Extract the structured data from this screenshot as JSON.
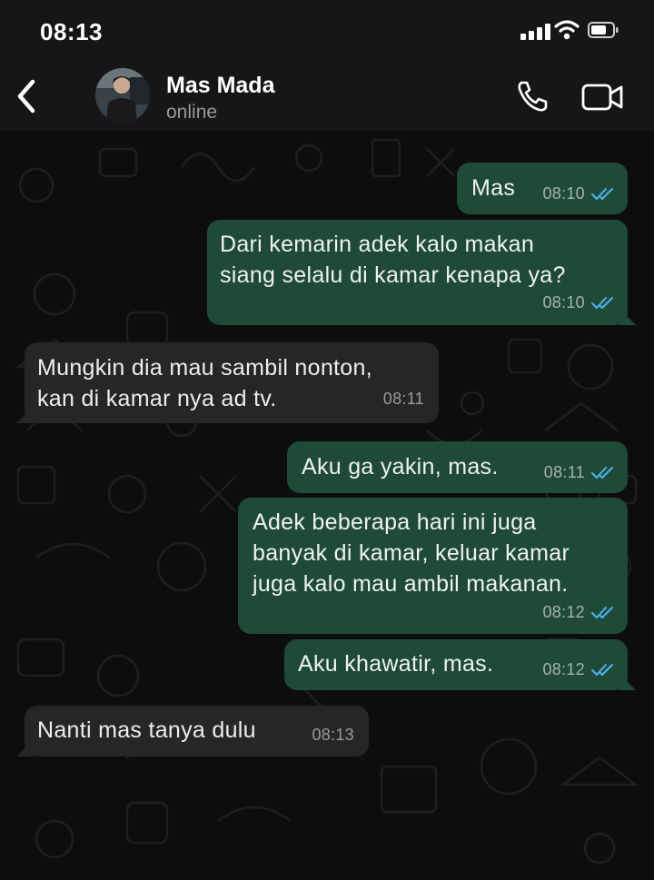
{
  "status_bar": {
    "time": "08:13"
  },
  "contact": {
    "name": "Mas Mada",
    "status": "online"
  },
  "messages": [
    {
      "direction": "out",
      "text": "Mas",
      "time": "08:10",
      "read": true
    },
    {
      "direction": "out",
      "text": "Dari kemarin adek kalo makan\nsiang selalu di kamar kenapa ya?",
      "time": "08:10",
      "read": true
    },
    {
      "direction": "in",
      "text": "Mungkin dia mau sambil nonton,\nkan di kamar nya ad tv.",
      "time": "08:11"
    },
    {
      "direction": "out",
      "text": "Aku ga yakin, mas.",
      "time": "08:11",
      "read": true
    },
    {
      "direction": "out",
      "text": "Adek beberapa hari ini juga\nbanyak di kamar, keluar kamar\njuga kalo mau ambil makanan.",
      "time": "08:12",
      "read": true
    },
    {
      "direction": "out",
      "text": "Aku khawatir, mas.",
      "time": "08:12",
      "read": true
    },
    {
      "direction": "in",
      "text": "Nanti mas tanya dulu",
      "time": "08:13"
    }
  ],
  "colors": {
    "outgoing_bubble": "#1f4a38",
    "incoming_bubble": "#262626",
    "read_ticks": "#4fb3f0",
    "header_bg": "#161616"
  },
  "icons": [
    "back-chevron-icon",
    "phone-icon",
    "video-camera-icon",
    "signal-icon",
    "wifi-icon",
    "battery-icon",
    "double-check-icon"
  ]
}
